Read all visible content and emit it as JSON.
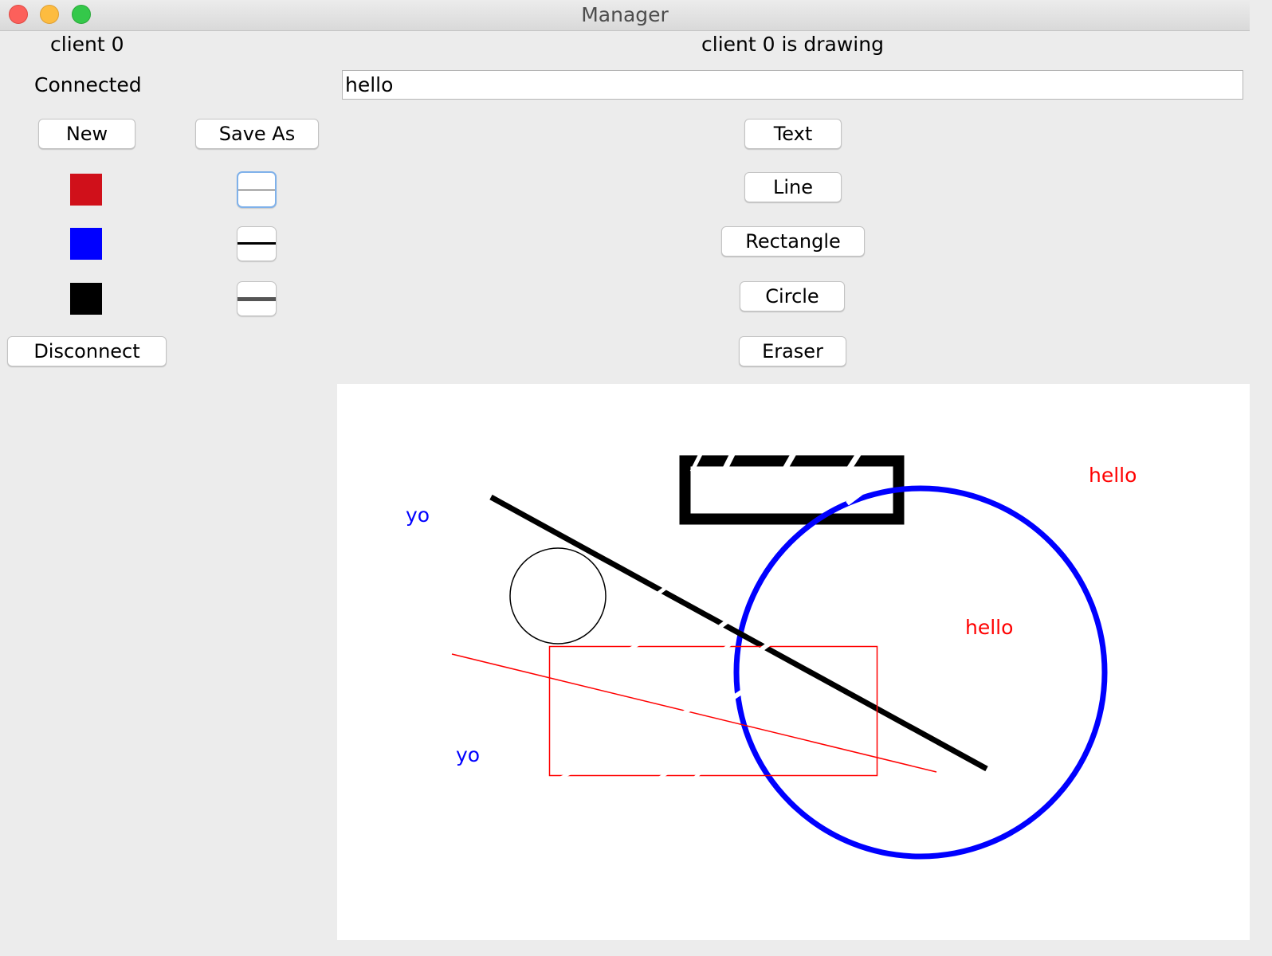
{
  "window": {
    "title": "Manager"
  },
  "header": {
    "client_name": "client 0",
    "status": "Connected",
    "drawing_status": "client 0 is drawing"
  },
  "text_input": {
    "value": "hello"
  },
  "file_buttons": {
    "new_label": "New",
    "save_as_label": "Save As"
  },
  "tool_buttons": {
    "text_label": "Text",
    "line_label": "Line",
    "rectangle_label": "Rectangle",
    "circle_label": "Circle",
    "eraser_label": "Eraser"
  },
  "colors": [
    {
      "name": "red",
      "hex": "#d0101a"
    },
    {
      "name": "blue",
      "hex": "#0000ff"
    },
    {
      "name": "black",
      "hex": "#000000"
    }
  ],
  "stroke_widths": {
    "options": [
      "thin",
      "medium",
      "thick"
    ],
    "selected": "thin"
  },
  "disconnect_label": "Disconnect",
  "canvas": {
    "texts": [
      "yo",
      "yo",
      "hello",
      "hello"
    ],
    "text_colors": [
      "#0000ff",
      "#0000ff",
      "#ff0000",
      "#ff0000"
    ]
  }
}
